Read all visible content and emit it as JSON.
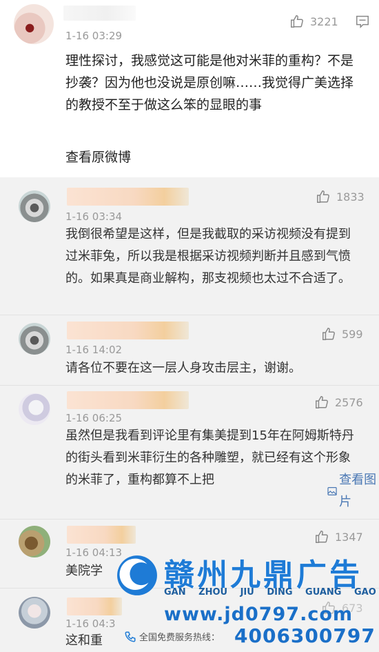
{
  "main_comment": {
    "time": "1-16 03:29",
    "likes": "3221",
    "text": "理性探讨，我感觉这可能是他对米菲的重构？不是抄袭？因为他也没说是原创嘛……我觉得广美选择的教授不至于做这么笨的显眼的事",
    "view_original": "查看原微博"
  },
  "replies": [
    {
      "time": "1-16 03:34",
      "likes": "1833",
      "text": "我倒很希望是这样，但是我截取的采访视频没有提到过米菲兔，所以我是根据采访视频判断并且感到气愤的。如果真是商业解构，那支视频也太过不合适了。"
    },
    {
      "time": "1-16 14:02",
      "likes": "599",
      "text": "请各位不要在这一层人身攻击层主，谢谢。"
    },
    {
      "time": "1-16 06:25",
      "likes": "2576",
      "text": "虽然但是我看到评论里有集美提到15年在阿姆斯特丹的街头看到米菲衍生的各种雕塑，就已经有这个形象的米菲了，重构都算不上把",
      "view_image": "查看图片"
    },
    {
      "time": "1-16 04:13",
      "likes": "1347",
      "text": "美院学"
    },
    {
      "time": "1-16 04:3",
      "likes": "673",
      "text": "这和重"
    }
  ],
  "watermark": {
    "title": "赣州九鼎广告",
    "pinyin": "GAN ZHOU JIU DING GUANG GAO",
    "url": "www.jd0797.com",
    "hotline_label": "全国免费服务热线：",
    "phone": "4006300797"
  },
  "colors": {
    "link": "#4a78b4",
    "watermark_blue": "#1e7bd6",
    "name_blur": "#f8d9c2"
  }
}
